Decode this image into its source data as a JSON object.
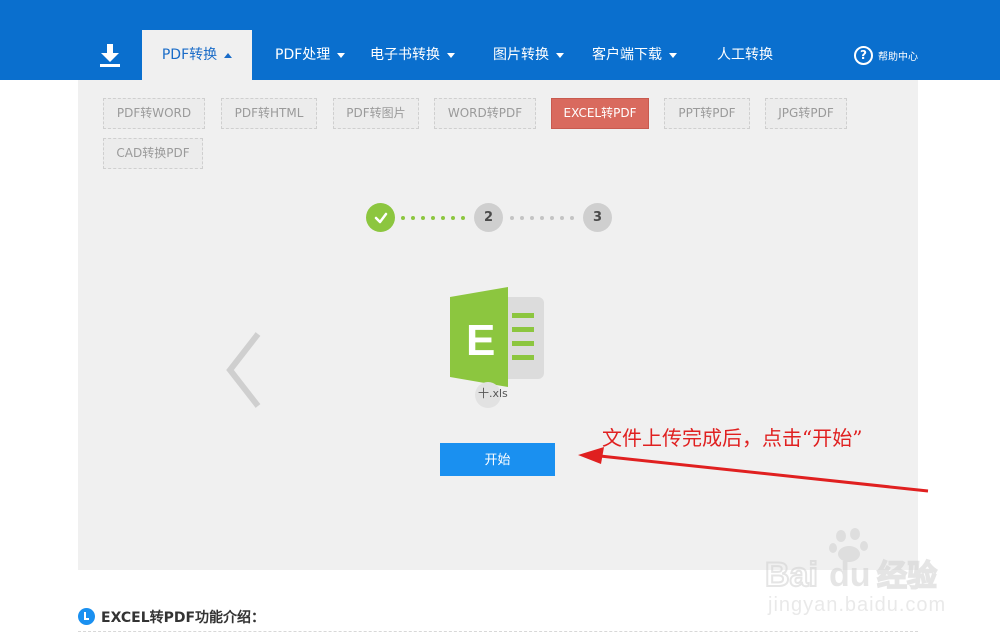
{
  "nav": {
    "items": [
      {
        "label": "PDF转换",
        "active": true
      },
      {
        "label": "PDF处理"
      },
      {
        "label": "电子书转换"
      },
      {
        "label": "图片转换"
      },
      {
        "label": "客户端下载"
      },
      {
        "label": "人工转换"
      }
    ],
    "help_label": "帮助中心"
  },
  "tags": [
    "PDF转WORD",
    "PDF转HTML",
    "PDF转图片",
    "WORD转PDF",
    "EXCEL转PDF",
    "PPT转PDF",
    "JPG转PDF",
    "CAD转换PDF"
  ],
  "active_tag": "EXCEL转PDF",
  "steps": {
    "step2": "2",
    "step3": "3"
  },
  "file": {
    "name": "十.xls",
    "icon_letter": "E"
  },
  "start_button": "开始",
  "annotation": "文件上传完成后，点击“开始”",
  "intro_title": "EXCEL转PDF功能介绍：",
  "watermark": {
    "url": "jingyan.baidu.com"
  },
  "colors": {
    "nav_bg": "#0a6fce",
    "active_tag": "#d96a5e",
    "step_done": "#8cc63f",
    "start_button": "#1a90f0",
    "annotation": "#e02020",
    "file_icon": "#8cc63f"
  }
}
